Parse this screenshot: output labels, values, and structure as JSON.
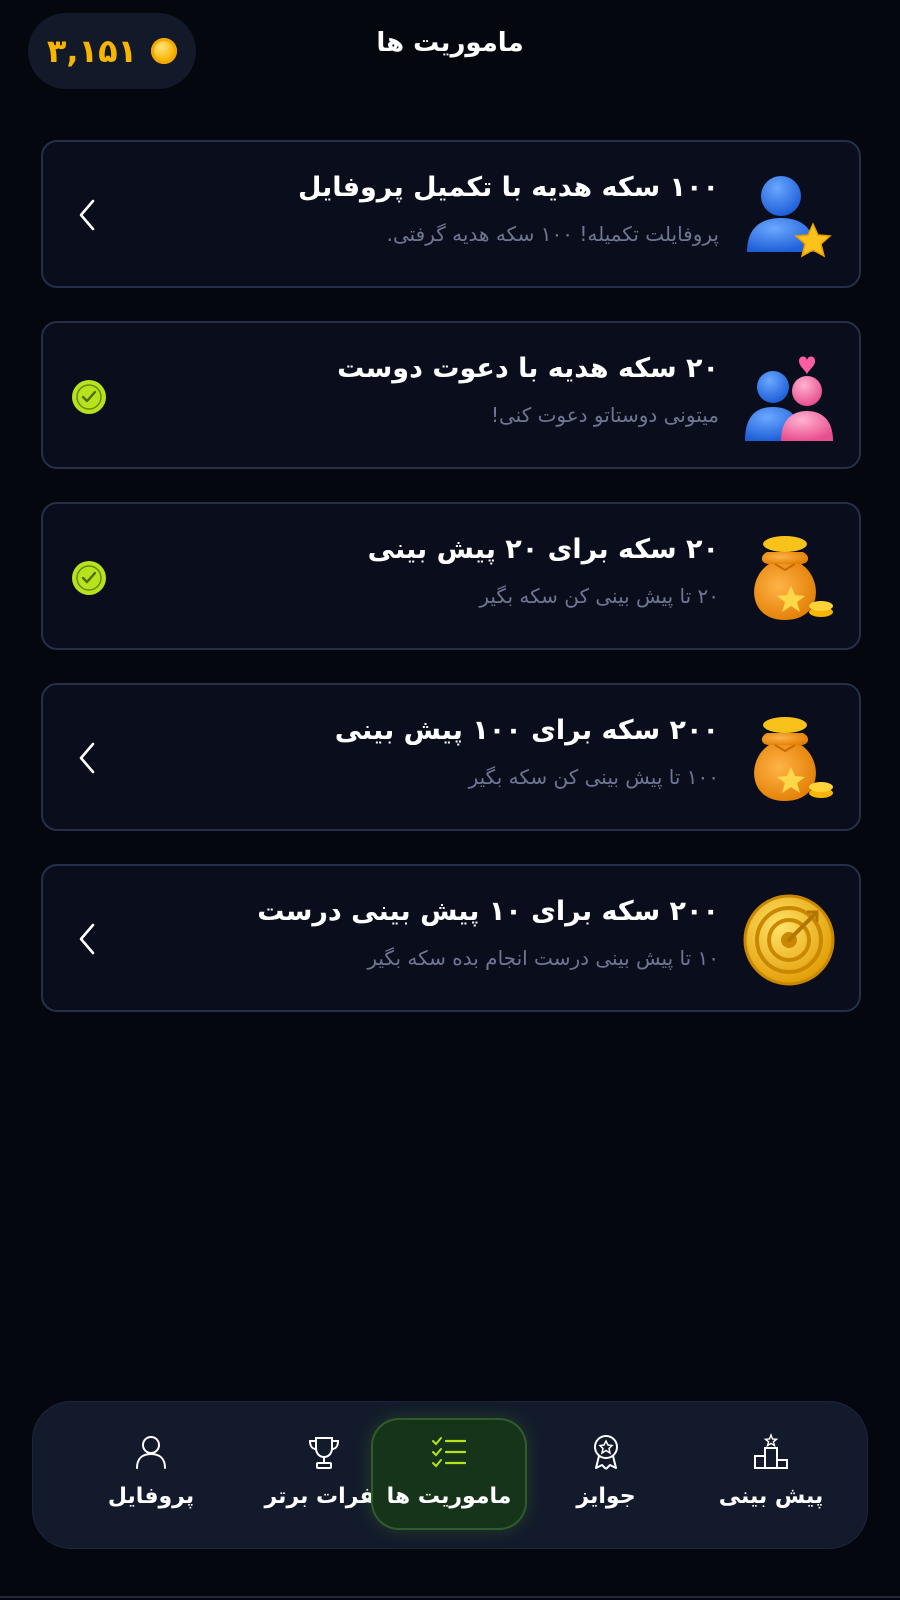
{
  "header": {
    "coin_balance": "۳,۱۵۱",
    "title": "ماموریت ها"
  },
  "missions": [
    {
      "title": "۱۰۰ سکه هدیه با تکمیل پروفایل",
      "description": "پروفایلت تکمیله! ۱۰۰ سکه هدیه گرفتی.",
      "icon": "user-star-icon",
      "status": "open"
    },
    {
      "title": "۲۰ سکه هدیه با دعوت دوست",
      "description": "میتونی دوستاتو دعوت کنی!",
      "icon": "friends-heart-icon",
      "status": "completed"
    },
    {
      "title": "۲۰ سکه برای ۲۰ پیش بینی",
      "description": "۲۰ تا پیش بینی کن سکه بگیر",
      "icon": "coin-bag-icon",
      "status": "completed"
    },
    {
      "title": "۲۰۰ سکه برای ۱۰۰ پیش بینی",
      "description": "۱۰۰ تا پیش بینی کن سکه بگیر",
      "icon": "coin-bag-icon",
      "status": "open"
    },
    {
      "title": "۲۰۰ سکه برای ۱۰ پیش بینی درست",
      "description": "۱۰ تا پیش بینی درست انجام بده سکه بگیر",
      "icon": "target-coin-icon",
      "status": "open"
    }
  ],
  "nav": {
    "items": [
      {
        "label": "پروفایل",
        "icon": "user-icon",
        "active": false
      },
      {
        "label": "نفرات برتر",
        "icon": "trophy-icon",
        "active": false
      },
      {
        "label": "ماموریت ها",
        "icon": "checklist-icon",
        "active": true
      },
      {
        "label": "جوایز",
        "icon": "medal-icon",
        "active": false
      },
      {
        "label": "پیش بینی",
        "icon": "podium-icon",
        "active": false
      }
    ]
  },
  "colors": {
    "background": "#05070e",
    "accent_coin": "#f7b500",
    "accent_green": "#b7e31d",
    "card_border": "#262f4a",
    "muted_text": "#6e7692"
  }
}
